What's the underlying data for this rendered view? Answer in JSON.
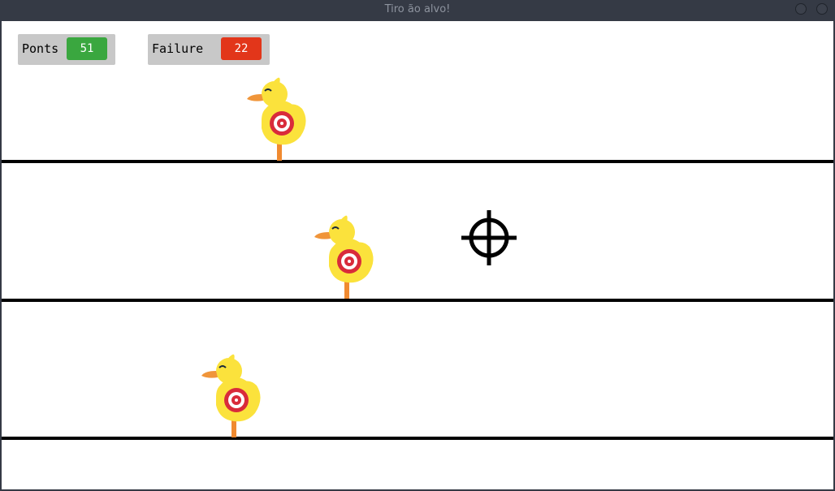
{
  "window": {
    "title": "Tiro ão alvo!"
  },
  "hud": {
    "points": {
      "label": "Ponts",
      "value": "51",
      "color": "#3aa73f"
    },
    "failures": {
      "label": "Failure",
      "value": "22",
      "color": "#e2361a"
    }
  },
  "colors": {
    "lane_line": "#000000",
    "background": "#ffffff",
    "duck_body": "#fbe23c",
    "duck_beak": "#f0953a",
    "target_red": "#d92b3a",
    "stick": "#f08a30"
  },
  "icons": {
    "duck_target": "duck-target-icon",
    "crosshair": "crosshair-icon"
  }
}
